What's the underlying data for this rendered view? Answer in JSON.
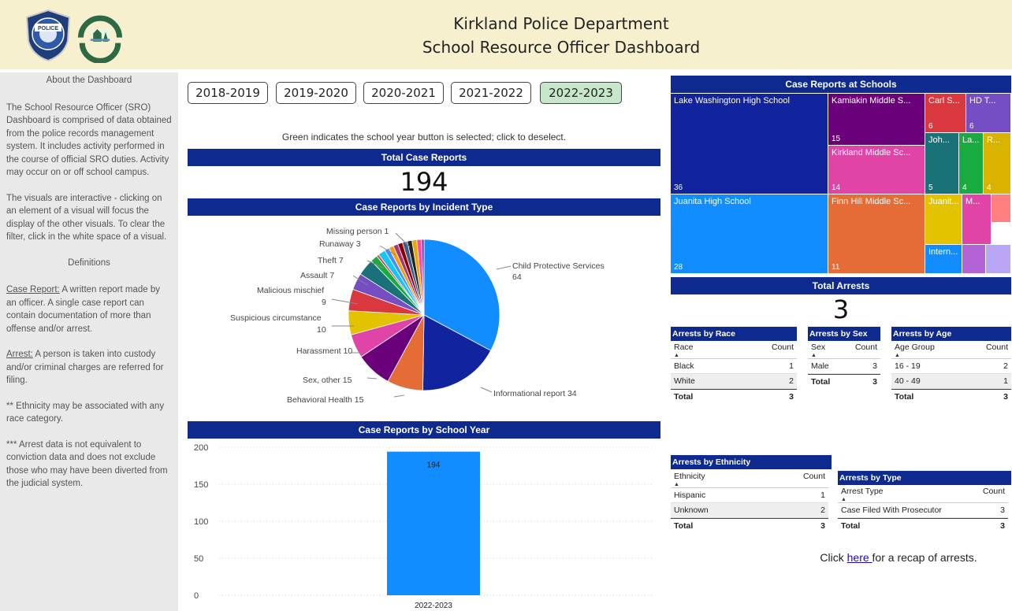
{
  "header": {
    "title_line1": "Kirkland Police Department",
    "title_line2": "School Resource Officer Dashboard",
    "police_logo_text": "KIRKLAND POLICE",
    "city_logo_text": "CITY OF KIRKLAND WASHINGTON"
  },
  "sidebar": {
    "about_title": "About the Dashboard",
    "about_p1": "The School Resource Officer (SRO) Dashboard is comprised of data obtained from the police records management system.  It includes activity performed in the course of official SRO duties. Activity may occur on or off school campus.",
    "about_p2": "The visuals are interactive - clicking on an element of a visual will focus the display of the other visuals. To clear the filter, click in the white space of a visual.",
    "definitions_title": "Definitions",
    "case_report_term": "Case Report:",
    "case_report_def": " A written report made by an officer. A single case report can contain documentation of more than offense and/or arrest.",
    "arrest_term": "Arrest:",
    "arrest_def": " A person is taken into custody and/or criminal charges are referred for filing.",
    "note_ethnicity": "** Ethnicity may be associated with any race category.",
    "note_arrest": "*** Arrest data is not equivalent to conviction data and does not exclude those who may have been diverted from the judicial system."
  },
  "year_buttons": [
    {
      "label": "2018-2019",
      "selected": false
    },
    {
      "label": "2019-2020",
      "selected": false
    },
    {
      "label": "2020-2021",
      "selected": false
    },
    {
      "label": "2021-2022",
      "selected": false
    },
    {
      "label": "2022-2023",
      "selected": true
    }
  ],
  "hint": "Green indicates the school year button is selected; click to deselect.",
  "total_case_reports": {
    "title": "Total Case Reports",
    "value": "194"
  },
  "incident_type": {
    "title": "Case Reports by Incident Type",
    "slices": [
      {
        "label": "Child Protective Services",
        "value": 64,
        "color": "#118dff"
      },
      {
        "label": "Informational report",
        "value": 34,
        "color": "#12239e"
      },
      {
        "label": "Behavioral Health",
        "value": 15,
        "color": "#e66c37"
      },
      {
        "label": "Sex, other",
        "value": 15,
        "color": "#6b007b"
      },
      {
        "label": "Harassment",
        "value": 10,
        "color": "#e044a7"
      },
      {
        "label": "Suspicious circumstance",
        "value": 10,
        "color": "#e3c300"
      },
      {
        "label": "Malicious mischief",
        "value": 9,
        "color": "#d9383f"
      },
      {
        "label": "Assault",
        "value": 7,
        "color": "#744ec2"
      },
      {
        "label": "Theft",
        "value": 7,
        "color": "#197278"
      },
      {
        "label": "Runaway",
        "value": 3,
        "color": "#1aab40"
      },
      {
        "label": "Missing person",
        "value": 1,
        "color": "#d64550"
      },
      {
        "label": "",
        "value": 3,
        "color": "#15c6f4"
      },
      {
        "label": "",
        "value": 2,
        "color": "#4092ff"
      },
      {
        "label": "",
        "value": 2,
        "color": "#ff9b00"
      },
      {
        "label": "",
        "value": 2,
        "color": "#a43b76"
      },
      {
        "label": "",
        "value": 2,
        "color": "#8b0000"
      },
      {
        "label": "",
        "value": 2,
        "color": "#3c5c8f"
      },
      {
        "label": "",
        "value": 2,
        "color": "#222222"
      },
      {
        "label": "",
        "value": 2,
        "color": "#e9a700"
      },
      {
        "label": "",
        "value": 2,
        "color": "#ff4a9d"
      },
      {
        "label": "",
        "value": 1,
        "color": "#6e2e9e"
      }
    ],
    "labels": {
      "cps": "Child Protective Services",
      "cps_val": "64",
      "info": "Informational report 34",
      "behav": "Behavioral Health 15",
      "sex": "Sex, other 15",
      "harass": "Harassment 10",
      "susp1": "Suspicious circumstance",
      "susp2": "10",
      "malic1": "Malicious mischief",
      "malic2": "9",
      "assault": "Assault 7",
      "theft": "Theft 7",
      "runaway": "Runaway 3",
      "missing": "Missing person 1"
    }
  },
  "chart_data": {
    "type": "bar",
    "title": "Case Reports by School Year",
    "categories": [
      "2022-2023"
    ],
    "values": [
      194
    ],
    "ylim": [
      0,
      200
    ],
    "yticks": [
      "200",
      "150",
      "100",
      "50",
      "0"
    ],
    "color": "#118dff",
    "data_label": "194"
  },
  "schools": {
    "title": "Case Reports at Schools",
    "tiles": [
      {
        "label": "Lake Washington High School",
        "value": "36",
        "color": "#12239e"
      },
      {
        "label": "Juanita High School",
        "value": "28",
        "color": "#118dff"
      },
      {
        "label": "Kamiakin Middle S...",
        "value": "15",
        "color": "#6b007b"
      },
      {
        "label": "Kirkland Middle Sc...",
        "value": "14",
        "color": "#e044a7"
      },
      {
        "label": "Finn Hill Middle Sc...",
        "value": "11",
        "color": "#e66c37"
      },
      {
        "label": "Carl S...",
        "value": "6",
        "color": "#d9383f"
      },
      {
        "label": "HD T...",
        "value": "6",
        "color": "#744ec2"
      },
      {
        "label": "Joh...",
        "value": "5",
        "color": "#197278"
      },
      {
        "label": "La...",
        "value": "4",
        "color": "#1aab40"
      },
      {
        "label": "R...",
        "value": "4",
        "color": "#d9b300"
      },
      {
        "label": "Juanit...",
        "value": "",
        "color": "#e3c300"
      },
      {
        "label": "M...",
        "value": "",
        "color": "#e044a7"
      },
      {
        "label": "",
        "value": "",
        "color": "#ff7f7f"
      },
      {
        "label": "Intern...",
        "value": "",
        "color": "#118dff"
      },
      {
        "label": "",
        "value": "",
        "color": "#b463d6"
      },
      {
        "label": "",
        "value": "",
        "color": "#b9a7f5"
      }
    ]
  },
  "total_arrests": {
    "title": "Total Arrests",
    "value": "3"
  },
  "arrests_race": {
    "title": "Arrests by Race",
    "col1": "Race",
    "col2": "Count",
    "rows": [
      {
        "k": "Black",
        "v": "1"
      },
      {
        "k": "White",
        "v": "2"
      }
    ],
    "total_label": "Total",
    "total": "3"
  },
  "arrests_sex": {
    "title": "Arrests by Sex",
    "col1": "Sex",
    "col2": "Count",
    "rows": [
      {
        "k": "Male",
        "v": "3"
      }
    ],
    "total_label": "Total",
    "total": "3"
  },
  "arrests_age": {
    "title": "Arrests by Age",
    "col1": "Age Group",
    "col2": "Count",
    "rows": [
      {
        "k": "16 - 19",
        "v": "2"
      },
      {
        "k": "40 - 49",
        "v": "1"
      }
    ],
    "total_label": "Total",
    "total": "3"
  },
  "arrests_ethnicity": {
    "title": "Arrests by Ethnicity",
    "col1": "Ethnicity",
    "col2": "Count",
    "rows": [
      {
        "k": "Hispanic",
        "v": "1"
      },
      {
        "k": "Unknown",
        "v": "2"
      }
    ],
    "total_label": "Total",
    "total": "3"
  },
  "arrests_type": {
    "title": "Arrests by Type",
    "col1": "Arrest Type",
    "col2": "Count",
    "rows": [
      {
        "k": "Case Filed With Prosecutor",
        "v": "3"
      }
    ],
    "total_label": "Total",
    "total": "3"
  },
  "recap": {
    "before": "Click ",
    "link": "here ",
    "after": "for a recap of arrests."
  }
}
